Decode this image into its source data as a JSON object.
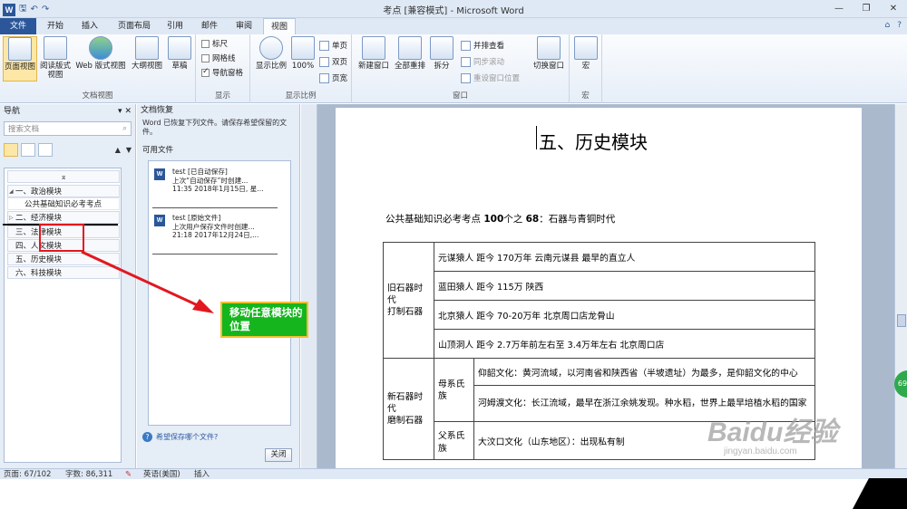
{
  "titlebar": {
    "title": "考点 [兼容模式] - Microsoft Word",
    "app_icon": "W",
    "qa_save": "🖫",
    "qa_undo": "↶",
    "qa_redo": "↷"
  },
  "tabs": {
    "file": "文件",
    "items": [
      "开始",
      "插入",
      "页面布局",
      "引用",
      "邮件",
      "审阅",
      "视图"
    ]
  },
  "ribbon": {
    "doc_views": {
      "label": "文档视图",
      "print_layout": "页面视图",
      "reading": "阅读版式视图",
      "web": "Web 版式视图",
      "outline": "大纲视图",
      "draft": "草稿"
    },
    "show": {
      "label": "显示",
      "ruler": "标尺",
      "gridlines": "网格线",
      "nav_pane": "导航窗格"
    },
    "zoom": {
      "label": "显示比例",
      "zoom": "显示比例",
      "percent": "100%",
      "one_page": "单页",
      "two_pages": "双页",
      "page_width": "页宽"
    },
    "window": {
      "label": "窗口",
      "new_window": "新建窗口",
      "arrange_all": "全部重排",
      "split": "拆分",
      "side_by_side": "并排查看",
      "sync_scroll": "同步滚动",
      "reset_pos": "重设窗口位置",
      "switch": "切换窗口"
    },
    "macro": {
      "label": "宏",
      "macro": "宏"
    }
  },
  "nav": {
    "title": "导航",
    "search_placeholder": "搜索文档",
    "items": [
      {
        "label": "一、政治模块"
      },
      {
        "label": "公共基础知识必考考点"
      },
      {
        "label": "二、经济模块"
      },
      {
        "label": "三、法律模块"
      },
      {
        "label": "四、人文模块"
      },
      {
        "label": "五、历史模块"
      },
      {
        "label": "六、科技模块"
      }
    ]
  },
  "recovery": {
    "title": "文档恢复",
    "desc": "Word 已恢复下列文件。请保存希望保留的文件。",
    "available": "可用文件",
    "files": [
      {
        "name": "test [已自动保存]",
        "line2": "上次“自动保存”时创建...",
        "line3": "11:35 2018年1月15日, 星..."
      },
      {
        "name": "test [原始文件]",
        "line2": "上次用户保存文件时创建...",
        "line3": "21:18 2017年12月24日,..."
      }
    ],
    "help": "希望保存哪个文件?",
    "close": "关闭"
  },
  "document": {
    "heading": "五、历史模块",
    "sub_prefix": "公共基础知识必考考点 ",
    "sub_num": "100",
    "sub_mid": "个之 ",
    "sub_num2": "68",
    "sub_suffix": "：石器与青铜时代",
    "table": {
      "paleolithic": "旧石器时代\n打制石器",
      "neolithic": "新石器时代\n磨制石器",
      "matriarchal": "母系氏族",
      "patriarchal": "父系氏族",
      "rows": [
        "元谋猿人 距今 170万年  云南元谋县 最早的直立人",
        "蓝田猿人 距今 115万 陕西",
        "北京猿人 距今 70-20万年 北京周口店龙骨山",
        "山顶洞人 距今 2.7万年前左右至 3.4万年左右 北京周口店",
        "仰韶文化：黄河流域，以河南省和陕西省（半坡遗址）为最多，是仰韶文化的中心",
        "河姆渡文化：长江流域，最早在浙江余姚发现。种水稻，世界上最早培植水稻的国家",
        "大汶口文化（山东地区）：出现私有制"
      ]
    }
  },
  "status": {
    "page": "页面: 67/102",
    "words": "字数: 86,311",
    "lang": "英语(美国)",
    "mode": "插入"
  },
  "annotation": {
    "callout": "移动任意模块的位置",
    "callout_bg": "#15b51e",
    "box_color": "#e3171f"
  },
  "watermark": {
    "main": "Baidu经验",
    "sub": "jingyan.baidu.com"
  },
  "side_badge": "69"
}
